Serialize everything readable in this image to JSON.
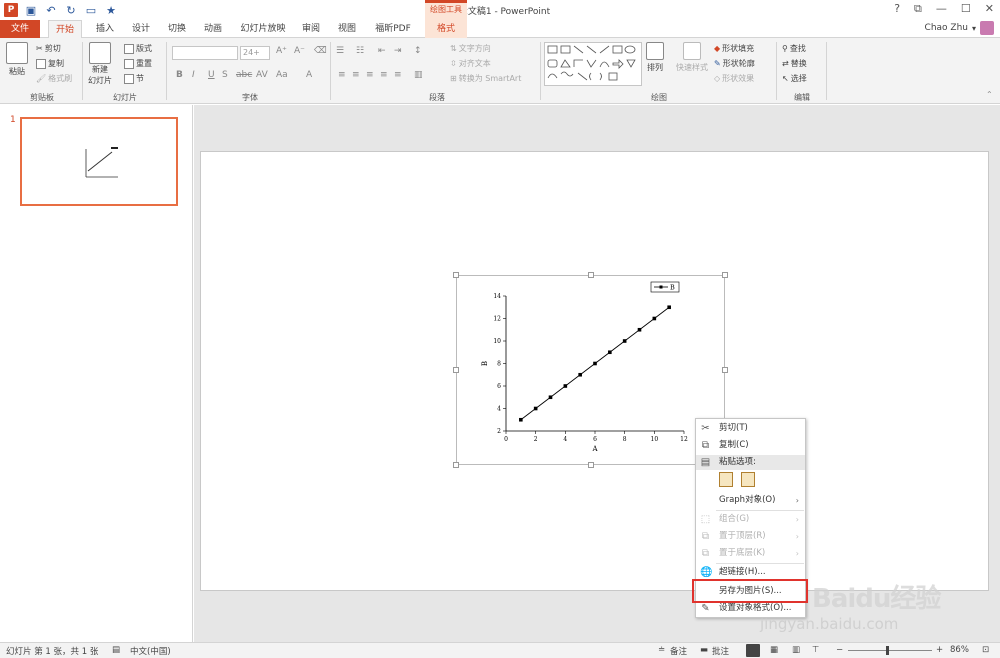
{
  "title_bar": {
    "doc_title": "演示文稿1 - PowerPoint",
    "contextual_tab_group": "绘图工具",
    "qat_icons": [
      "save-icon",
      "undo-icon",
      "redo-icon",
      "present-icon",
      "customize-icon"
    ],
    "window_controls": [
      "?",
      "⧉",
      "—",
      "☐",
      "✕"
    ]
  },
  "tabs": [
    "文件",
    "开始",
    "插入",
    "设计",
    "切换",
    "动画",
    "幻灯片放映",
    "审阅",
    "视图",
    "福昕PDF",
    "格式"
  ],
  "active_tab": "开始",
  "user": {
    "name": "Chao Zhu"
  },
  "ribbon": {
    "clipboard": {
      "paste": "粘贴",
      "cut": "剪切",
      "copy": "复制",
      "format_painter": "格式刷",
      "label": "剪贴板"
    },
    "slides": {
      "new_slide_line1": "新建",
      "new_slide_line2": "幻灯片",
      "layout": "版式",
      "reset": "重置",
      "section": "节",
      "label": "幻灯片"
    },
    "font": {
      "size": "24+",
      "label": "字体"
    },
    "paragraph": {
      "text_direction": "文字方向",
      "align_text": "对齐文本",
      "convert_smartart": "转换为 SmartArt",
      "label": "段落"
    },
    "drawing": {
      "arrange": "排列",
      "quick_styles": "快速样式",
      "shape_fill": "形状填充",
      "shape_outline": "形状轮廓",
      "shape_effects": "形状效果",
      "label": "绘图"
    },
    "editing": {
      "find": "查找",
      "replace": "替换",
      "select": "选择",
      "label": "编辑"
    }
  },
  "slide_panel": {
    "slide_number": "1"
  },
  "chart_data": {
    "type": "line",
    "x": [
      1,
      2,
      3,
      4,
      5,
      6,
      7,
      8,
      9,
      10,
      11
    ],
    "series": [
      {
        "name": "B",
        "values": [
          3,
          4,
          5,
          6,
          7,
          8,
          9,
          10,
          11,
          12,
          13
        ]
      }
    ],
    "xlabel": "A",
    "ylabel": "B",
    "xlim": [
      0,
      12
    ],
    "ylim": [
      2,
      14
    ],
    "xticks": [
      "0",
      "2",
      "4",
      "6",
      "8",
      "10",
      "12"
    ],
    "yticks": [
      "2",
      "4",
      "6",
      "8",
      "10",
      "12",
      "14"
    ],
    "legend_position": "top-right",
    "grid": false
  },
  "context_menu": {
    "items": [
      {
        "label": "剪切(T)",
        "icon": "scissors-icon",
        "disabled": false
      },
      {
        "label": "复制(C)",
        "icon": "copy-icon",
        "disabled": false
      },
      {
        "label": "粘贴选项:",
        "icon": "paste-icon",
        "disabled": false
      },
      {
        "label": "Graph对象(O)",
        "icon": "",
        "disabled": false
      },
      {
        "label": "组合(G)",
        "icon": "group-icon",
        "disabled": true
      },
      {
        "label": "置于顶层(R)",
        "icon": "bring-front-icon",
        "disabled": true
      },
      {
        "label": "置于底层(K)",
        "icon": "send-back-icon",
        "disabled": true
      },
      {
        "label": "超链接(H)...",
        "icon": "hyperlink-icon",
        "disabled": false
      },
      {
        "label": "另存为图片(S)...",
        "icon": "",
        "disabled": false
      },
      {
        "label": "设置对象格式(O)...",
        "icon": "format-object-icon",
        "disabled": false
      }
    ]
  },
  "status_bar": {
    "slide_info": "幻灯片 第 1 张，共 1 张",
    "language": "中文(中国)",
    "notes": "备注",
    "comments": "批注",
    "zoom": "86%"
  },
  "watermark": {
    "logo": "Baidu经验",
    "url": "jingyan.baidu.com"
  },
  "colors": {
    "accent": "#d24726",
    "highlight_box": "#e0332d",
    "thumb_border": "#e86e43"
  }
}
